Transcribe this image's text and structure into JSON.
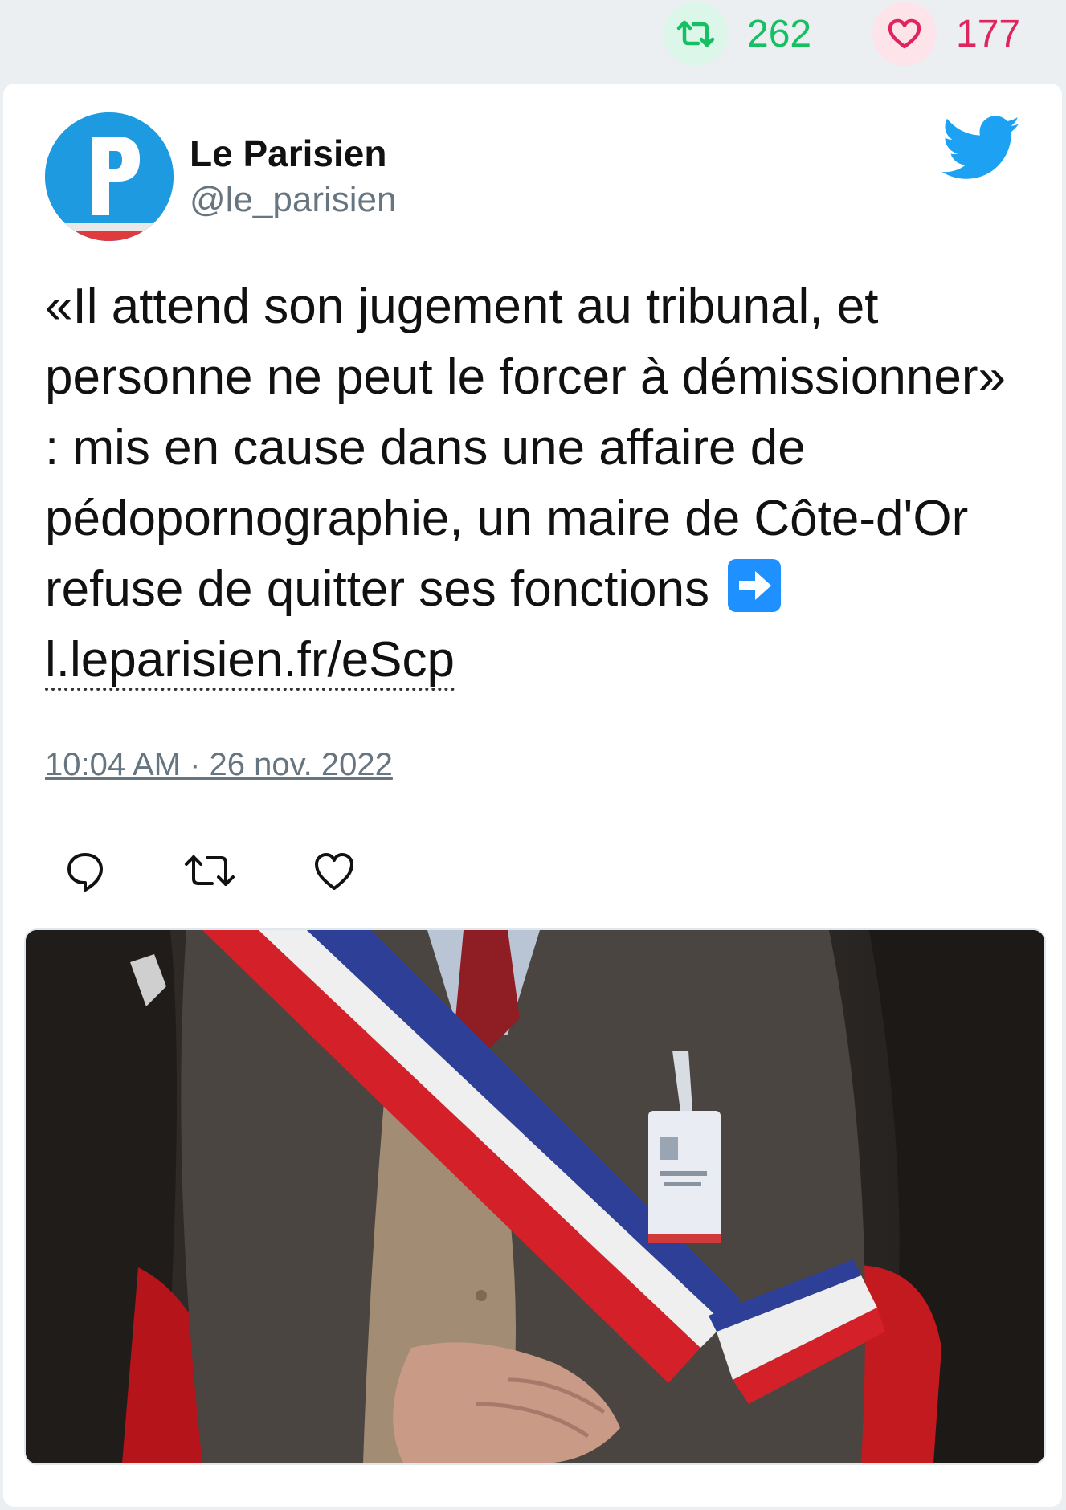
{
  "stats": {
    "retweets": "262",
    "likes": "177"
  },
  "author": {
    "name": "Le Parisien",
    "handle": "@le_parisien"
  },
  "tweet": {
    "text": "«Il attend son jugement au tribunal, et personne ne peut le forcer à démissionner» : mis en cause dans une affaire de pédopornographie, un maire de Côte-d'Or refuse de quitter ses fonctions",
    "link": "l.leparisien.fr/eScp",
    "timestamp": "10:04 AM · 26 nov. 2022"
  },
  "icons": {
    "retweet_stat": "retweet-icon",
    "like_stat": "heart-icon",
    "brand": "twitter-bird-icon",
    "reply": "reply-icon",
    "retweet": "retweet-icon",
    "like": "heart-icon",
    "emoji": "right-arrow-emoji"
  },
  "colors": {
    "retweet": "#17bf63",
    "like": "#e0245e",
    "twitter_blue": "#1da1f2",
    "avatar_blue": "#1e9be0"
  }
}
